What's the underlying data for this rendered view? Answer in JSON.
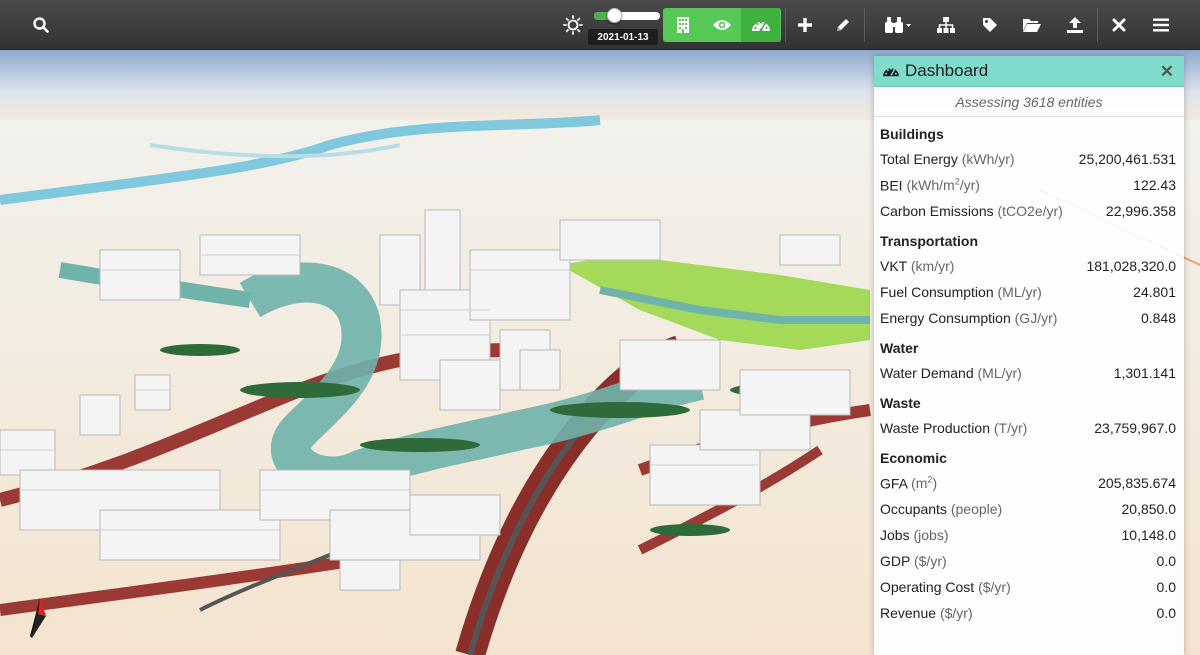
{
  "toolbar": {
    "date": "2021-01-13",
    "time_slider_value": 0.35,
    "icons": [
      "search-icon",
      "brightness-icon",
      "buildings-icon",
      "eye-icon",
      "dashboard-icon",
      "plus-icon",
      "pencil-icon",
      "binoculars-icon",
      "hierarchy-icon",
      "tag-icon",
      "folder-open-icon",
      "upload-icon",
      "close-icon",
      "menu-icon"
    ]
  },
  "dashboard": {
    "title": "Dashboard",
    "subtitle": "Assessing 3618 entities",
    "sections": {
      "buildings": "Buildings",
      "transportation": "Transportation",
      "water": "Water",
      "waste": "Waste",
      "economic": "Economic"
    },
    "rows": {
      "total_energy": {
        "label": "Total Energy",
        "unit": "(kWh/yr)",
        "value": "25,200,461.531"
      },
      "bei": {
        "label": "BEI",
        "unit_pre": "(kWh/m",
        "unit_sup": "2",
        "unit_post": "/yr)",
        "value": "122.43"
      },
      "carbon": {
        "label": "Carbon Emissions",
        "unit": "(tCO2e/yr)",
        "value": "22,996.358"
      },
      "vkt": {
        "label": "VKT",
        "unit": "(km/yr)",
        "value": "181,028,320.0"
      },
      "fuel": {
        "label": "Fuel Consumption",
        "unit": "(ML/yr)",
        "value": "24.801"
      },
      "energy_cons": {
        "label": "Energy Consumption",
        "unit": "(GJ/yr)",
        "value": "0.848"
      },
      "water_demand": {
        "label": "Water Demand",
        "unit": "(ML/yr)",
        "value": "1,301.141"
      },
      "waste_prod": {
        "label": "Waste Production",
        "unit": "(T/yr)",
        "value": "23,759,967.0"
      },
      "gfa": {
        "label": "GFA",
        "unit_pre": "(m",
        "unit_sup": "2",
        "unit_post": ")",
        "value": "205,835.674"
      },
      "occupants": {
        "label": "Occupants",
        "unit": "(people)",
        "value": "20,850.0"
      },
      "jobs": {
        "label": "Jobs",
        "unit": "(jobs)",
        "value": "10,148.0"
      },
      "gdp": {
        "label": "GDP",
        "unit": "($/yr)",
        "value": "0.0"
      },
      "opcost": {
        "label": "Operating Cost",
        "unit": "($/yr)",
        "value": "0.0"
      },
      "revenue": {
        "label": "Revenue",
        "unit": "($/yr)",
        "value": "0.0"
      }
    }
  },
  "colors": {
    "toolbar": "#3a3a3a",
    "active_green": "#56c856",
    "panel_header": "#7fdccc"
  }
}
